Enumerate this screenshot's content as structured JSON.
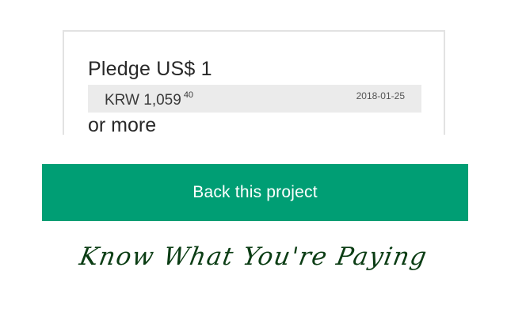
{
  "pledge": {
    "label": "Pledge US$ 1",
    "conversion_amount": "KRW 1,059",
    "conversion_cents": "40",
    "conversion_date": "2018-01-25",
    "suffix": "or more"
  },
  "action": {
    "back_label": "Back this project"
  },
  "caption": {
    "text": "Know What You're Paying"
  },
  "colors": {
    "button_green": "#009e74",
    "caption_green": "#0b3d14",
    "conversion_bg": "#ebebeb",
    "card_border": "#e2e2e2"
  }
}
